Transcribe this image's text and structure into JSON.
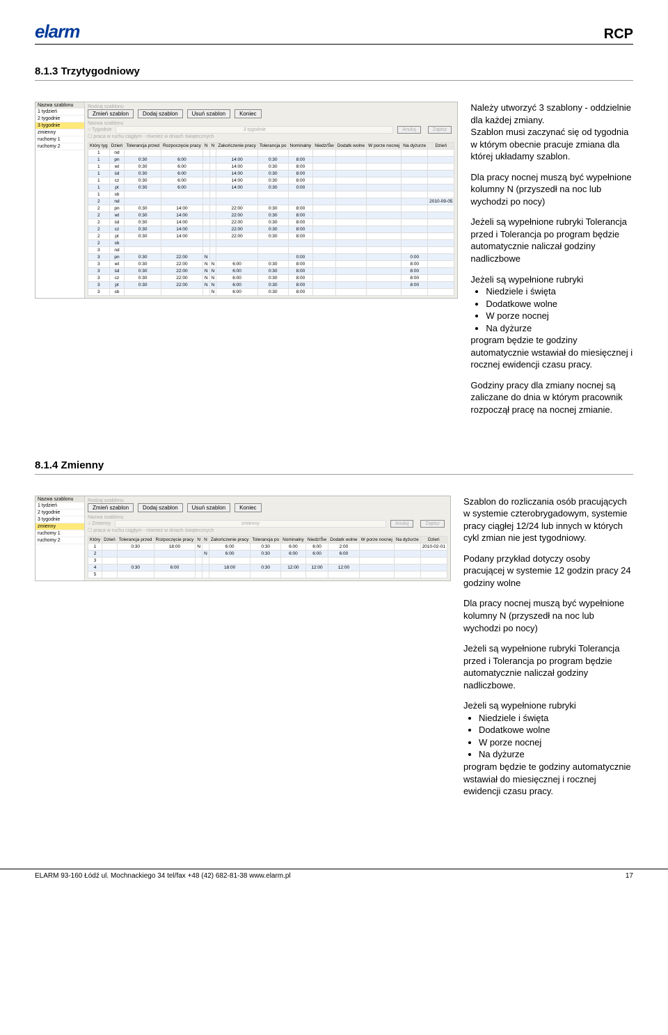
{
  "header": {
    "logo": "elarm",
    "rcp": "RCP"
  },
  "section1": {
    "title": "8.1.3 Trzytygodniowy",
    "paras": [
      "Należy utworzyć 3 szablony - oddzielnie dla każdej zmiany.",
      "Szablon musi zaczynać się od tygodnia w którym obecnie pracuje zmiana dla której układamy szablon.",
      "Dla pracy nocnej muszą być wypełnione kolumny N (przyszedł na noc lub wychodzi po nocy)",
      "Jeżeli są wypełnione rubryki Tolerancja przed i Tolerancja po program będzie automatycznie naliczał godziny nadliczbowe",
      "Jeżeli są wypełnione rubryki"
    ],
    "bullets": [
      "Niedziele i święta",
      "Dodatkowe wolne",
      "W porze nocnej",
      "Na dyżurze"
    ],
    "para_after": "program będzie te godziny automatycznie wstawiał do miesięcznej i rocznej ewidencji czasu pracy.",
    "para_last": "Godziny pracy dla zmiany nocnej są zaliczane do dnia w którym pracownik rozpoczął pracę na nocnej zmianie."
  },
  "section2": {
    "title": "8.1.4 Zmienny",
    "paras": [
      "Szablon do rozliczania osób pracujących w systemie czterobrygadowym, systemie pracy ciągłej 12/24 lub innych w których cykl zmian nie jest tygodniowy.",
      "Podany przykład dotyczy osoby pracującej w systemie 12 godzin pracy 24 godziny wolne",
      "Dla pracy nocnej muszą być wypełnione kolumny N (przyszedł na noc lub wychodzi po nocy)",
      "Jeżeli są wypełnione rubryki Tolerancja przed i Tolerancja po program będzie automatycznie naliczał godziny nadliczbowe.",
      "Jeżeli są wypełnione rubryki"
    ],
    "bullets": [
      "Niedziele i święta",
      "Dodatkowe wolne",
      "W porze nocnej",
      "Na dyżurze"
    ],
    "para_after": "program będzie te godziny automatycznie wstawiał do miesięcznej i rocznej ewidencji czasu pracy."
  },
  "ui": {
    "list_header": "Nazwa szablonu",
    "list_items": [
      "1 tydzień",
      "2 tygodnie",
      "3 tygodnie",
      "zmienny",
      "ruchomy 1",
      "ruchomy 2"
    ],
    "buttons": {
      "zmien": "Zmień szablon",
      "dodaj": "Dodaj szablon",
      "usun": "Usuń szablon",
      "koniec": "Koniec",
      "anuluj": "Anuluj",
      "zapisz": "Zapisz"
    },
    "dim1": "Rodzaj szablonu",
    "dim_name": "Nazwa szablonu",
    "dim2": "Tygodnie",
    "sel1_name": "3 tygodnie",
    "sel2_name": "zmienny",
    "dim3": "Zmienny",
    "chk": "praca w ruchu ciągłym - również w dniach świątecznych",
    "headers": [
      "Który tyg",
      "Dzień",
      "Tolerancja przed",
      "Rozpoczęcie pracy",
      "N",
      "N",
      "Zakończenie pracy",
      "Tolerancja po",
      "Nominalny",
      "Niedz/Św",
      "Dodatk wolne",
      "W porze nocnej",
      "Na dyżurze",
      "Dzień"
    ],
    "headers2": [
      "Który",
      "Dzień",
      "Tolerancja przed",
      "Rozpoczęcie pracy",
      "N",
      "N",
      "Zakończenie pracy",
      "Tolerancja po",
      "Nominalny",
      "Niedz/Św",
      "Dodatk wolne",
      "W porze nocnej",
      "Na dyżurze",
      "Dzień"
    ],
    "rows1": [
      [
        "1",
        "nd",
        "",
        "",
        "",
        "",
        "",
        "",
        "",
        "",
        "",
        "",
        "",
        ""
      ],
      [
        "1",
        "pn",
        "0:30",
        "6:00",
        "",
        "",
        "14:00",
        "0:30",
        "8:00",
        "",
        "",
        "",
        "",
        ""
      ],
      [
        "1",
        "wt",
        "0:30",
        "6:00",
        "",
        "",
        "14:00",
        "0:30",
        "8:00",
        "",
        "",
        "",
        "",
        ""
      ],
      [
        "1",
        "śd",
        "0:30",
        "6:00",
        "",
        "",
        "14:00",
        "0:30",
        "8:00",
        "",
        "",
        "",
        "",
        ""
      ],
      [
        "1",
        "cz",
        "0:30",
        "6:00",
        "",
        "",
        "14:00",
        "0:30",
        "8:00",
        "",
        "",
        "",
        "",
        ""
      ],
      [
        "1",
        "pt",
        "0:30",
        "6:00",
        "",
        "",
        "14:00",
        "0:30",
        "0:00",
        "",
        "",
        "",
        "",
        ""
      ],
      [
        "1",
        "sb",
        "",
        "",
        "",
        "",
        "",
        "",
        "",
        "",
        "",
        "",
        "",
        ""
      ],
      [
        "2",
        "nd",
        "",
        "",
        "",
        "",
        "",
        "",
        "",
        "",
        "",
        "",
        "",
        "2010-09-05"
      ],
      [
        "2",
        "pn",
        "0:30",
        "14:00",
        "",
        "",
        "22:00",
        "0:30",
        "8:00",
        "",
        "",
        "",
        "",
        ""
      ],
      [
        "2",
        "wt",
        "0:30",
        "14:00",
        "",
        "",
        "22:00",
        "0:30",
        "8:00",
        "",
        "",
        "",
        "",
        ""
      ],
      [
        "2",
        "śd",
        "0:30",
        "14:00",
        "",
        "",
        "22:00",
        "0:30",
        "8:00",
        "",
        "",
        "",
        "",
        ""
      ],
      [
        "2",
        "cz",
        "0:30",
        "14:00",
        "",
        "",
        "22:00",
        "0:30",
        "8:00",
        "",
        "",
        "",
        "",
        ""
      ],
      [
        "2",
        "pt",
        "0:30",
        "14:00",
        "",
        "",
        "22:00",
        "0:30",
        "8:00",
        "",
        "",
        "",
        "",
        ""
      ],
      [
        "2",
        "sb",
        "",
        "",
        "",
        "",
        "",
        "",
        "",
        "",
        "",
        "",
        "",
        ""
      ],
      [
        "3",
        "nd",
        "",
        "",
        "",
        "",
        "",
        "",
        "",
        "",
        "",
        "",
        "",
        ""
      ],
      [
        "3",
        "pn",
        "0:30",
        "22:00",
        "N",
        "",
        "",
        "",
        "0:00",
        "",
        "",
        "",
        "0:00",
        ""
      ],
      [
        "3",
        "wt",
        "0:30",
        "22:00",
        "N",
        "N",
        "6:00",
        "0:30",
        "8:00",
        "",
        "",
        "",
        "8:00",
        ""
      ],
      [
        "3",
        "śd",
        "0:30",
        "22:00",
        "N",
        "N",
        "6:00",
        "0:30",
        "8:00",
        "",
        "",
        "",
        "8:00",
        ""
      ],
      [
        "3",
        "cz",
        "0:30",
        "22:00",
        "N",
        "N",
        "6:00",
        "0:30",
        "8:00",
        "",
        "",
        "",
        "8:00",
        ""
      ],
      [
        "3",
        "pt",
        "0:30",
        "22:00",
        "N",
        "N",
        "6:00",
        "0:30",
        "8:00",
        "",
        "",
        "",
        "8:00",
        ""
      ],
      [
        "3",
        "sb",
        "",
        "",
        "",
        "N",
        "6:00",
        "0:30",
        "8:00",
        "",
        "",
        "",
        "",
        ""
      ]
    ],
    "rows2": [
      [
        "1",
        "",
        "0:30",
        "18:00",
        "N",
        "",
        "6:00",
        "0:30",
        "6:00",
        "6:00",
        "2:00",
        "",
        "",
        "2010-02-01"
      ],
      [
        "2",
        "",
        "",
        "",
        "",
        "N",
        "6:00",
        "0:30",
        "6:00",
        "6:00",
        "6:00",
        "",
        "",
        ""
      ],
      [
        "3",
        "",
        "",
        "",
        "",
        "",
        "",
        "",
        "",
        "",
        "",
        "",
        "",
        ""
      ],
      [
        "4",
        "",
        "0:30",
        "6:00",
        "",
        "",
        "18:00",
        "0:30",
        "12:00",
        "12:00",
        "12:00",
        "",
        "",
        ""
      ],
      [
        "5",
        "",
        "",
        "",
        "",
        "",
        "",
        "",
        "",
        "",
        "",
        "",
        "",
        ""
      ]
    ]
  },
  "footer": {
    "left": "ELARM 93-160 Łódź ul. Mochnackiego 34 tel/fax +48 (42)  682-81-38  www.elarm.pl",
    "right": "17"
  }
}
